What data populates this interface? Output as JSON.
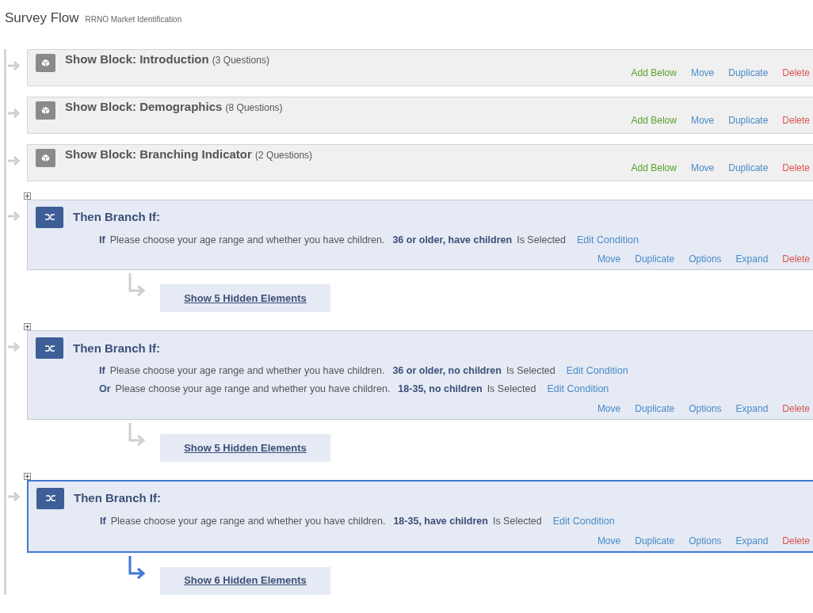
{
  "header": {
    "title": "Survey Flow",
    "subtitle": "RRNO Market Identification"
  },
  "flow": [
    {
      "kind": "block",
      "label": "Show Block:",
      "name": "Introduction",
      "count": "(3 Questions)",
      "actions": [
        {
          "label": "Add Below",
          "color": "#5aa02c"
        },
        {
          "label": "Move",
          "color": "#4a8ac9"
        },
        {
          "label": "Duplicate",
          "color": "#4a8ac9"
        },
        {
          "label": "Delete",
          "color": "#d9534f"
        }
      ]
    },
    {
      "kind": "block",
      "label": "Show Block:",
      "name": "Demographics",
      "count": "(8 Questions)",
      "actions": [
        {
          "label": "Add Below",
          "color": "#5aa02c"
        },
        {
          "label": "Move",
          "color": "#4a8ac9"
        },
        {
          "label": "Duplicate",
          "color": "#4a8ac9"
        },
        {
          "label": "Delete",
          "color": "#d9534f"
        }
      ]
    },
    {
      "kind": "block",
      "label": "Show Block:",
      "name": "Branching Indicator",
      "count": "(2 Questions)",
      "actions": [
        {
          "label": "Add Below",
          "color": "#5aa02c"
        },
        {
          "label": "Move",
          "color": "#4a8ac9"
        },
        {
          "label": "Duplicate",
          "color": "#4a8ac9"
        },
        {
          "label": "Delete",
          "color": "#d9534f"
        }
      ]
    },
    {
      "kind": "branch",
      "selected": false,
      "title": "Then Branch If:",
      "conditions": [
        {
          "connector": "If",
          "question": "Please choose your age range and whether you have children.",
          "answer": "36 or older, have children",
          "status": "Is Selected",
          "edit": "Edit Condition"
        }
      ],
      "actions": [
        {
          "label": "Move",
          "color": "#4a8ac9"
        },
        {
          "label": "Duplicate",
          "color": "#4a8ac9"
        },
        {
          "label": "Options",
          "color": "#4a8ac9"
        },
        {
          "label": "Expand",
          "color": "#4a8ac9"
        },
        {
          "label": "Delete",
          "color": "#d9534f"
        }
      ],
      "hidden": "Show 5 Hidden Elements"
    },
    {
      "kind": "branch",
      "selected": false,
      "title": "Then Branch If:",
      "conditions": [
        {
          "connector": "If",
          "question": "Please choose your age range and whether you have children.",
          "answer": "36 or older, no children",
          "status": "Is Selected",
          "edit": "Edit Condition"
        },
        {
          "connector": "Or",
          "question": "Please choose your age range and whether you have children.",
          "answer": "18-35, no children",
          "status": "Is Selected",
          "edit": "Edit Condition"
        }
      ],
      "actions": [
        {
          "label": "Move",
          "color": "#4a8ac9"
        },
        {
          "label": "Duplicate",
          "color": "#4a8ac9"
        },
        {
          "label": "Options",
          "color": "#4a8ac9"
        },
        {
          "label": "Expand",
          "color": "#4a8ac9"
        },
        {
          "label": "Delete",
          "color": "#d9534f"
        }
      ],
      "hidden": "Show 5 Hidden Elements"
    },
    {
      "kind": "branch",
      "selected": true,
      "title": "Then Branch If:",
      "conditions": [
        {
          "connector": "If",
          "question": "Please choose your age range and whether you have children.",
          "answer": "18-35, have children",
          "status": "Is Selected",
          "edit": "Edit Condition"
        }
      ],
      "actions": [
        {
          "label": "Move",
          "color": "#4a8ac9"
        },
        {
          "label": "Duplicate",
          "color": "#4a8ac9"
        },
        {
          "label": "Options",
          "color": "#4a8ac9"
        },
        {
          "label": "Expand",
          "color": "#4a8ac9"
        },
        {
          "label": "Delete",
          "color": "#d9534f"
        }
      ],
      "hidden": "Show 6 Hidden Elements"
    }
  ]
}
